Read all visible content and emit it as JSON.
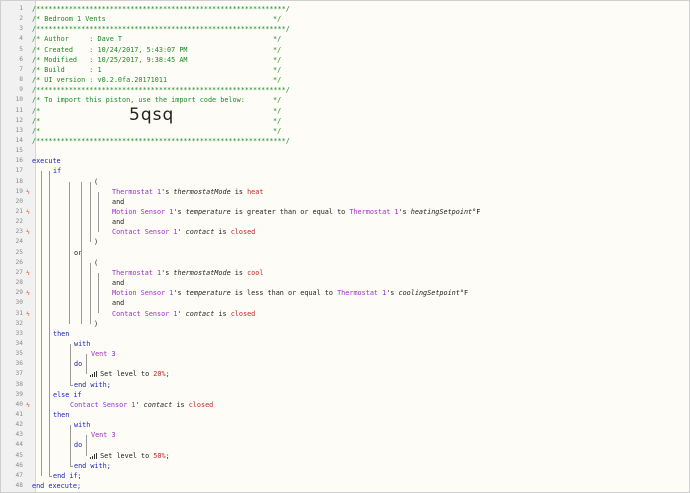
{
  "editor": {
    "line_numbers": [
      "1",
      "2",
      "3",
      "4",
      "5",
      "6",
      "7",
      "8",
      "9",
      "10",
      "11",
      "12",
      "13",
      "14",
      "15",
      "16",
      "17",
      "18",
      "19",
      "20",
      "21",
      "22",
      "23",
      "24",
      "25",
      "26",
      "27",
      "28",
      "29",
      "30",
      "31",
      "32",
      "33",
      "34",
      "35",
      "36",
      "37",
      "38",
      "39",
      "40",
      "41",
      "42",
      "43",
      "44",
      "45",
      "46",
      "47",
      "48"
    ],
    "marker_lines": [
      19,
      21,
      23,
      27,
      29,
      31,
      40
    ],
    "marker_glyph": "ϟ"
  },
  "header": {
    "rule": "/*************************************************************/",
    "title": "/* Bedroom 1 Vents",
    "author": "/* Author     : Dave T",
    "created": "/* Created    : 10/24/2017, 5:43:07 PM",
    "modified": "/* Modified   : 10/25/2017, 9:38:45 AM",
    "build": "/* Build      : 1",
    "ui_version": "/* UI version : v0.2.0fa.20171011",
    "import_note": "/* To import this piston, use the import code below:",
    "blank": "/*",
    "close": "*/",
    "import_code": "5qsq"
  },
  "code": {
    "execute": "execute",
    "if": "if",
    "open_paren": "(",
    "close_paren": ")",
    "or": "or",
    "and": "and",
    "then": "then",
    "with": "with",
    "do": "do",
    "end_with": "end with;",
    "else_if": "else if",
    "end_if": "end if;",
    "end_execute": "end execute;",
    "thermostat": "Thermostat 1",
    "s": "'s ",
    "thermostat_mode": "thermostatMode",
    "is": " is ",
    "heat": "heat",
    "cool": "cool",
    "motion_sensor": "Motion Sensor 1",
    "temperature": "temperature",
    "gte": " is greater than or equal to ",
    "lte": " is less than or equal to ",
    "heating_setpoint": "heatingSetpoint",
    "cooling_setpoint": "coolingSetpoint",
    "deg": "°F",
    "contact_sensor": "Contact Sensor 1",
    "apos": "' ",
    "contact": "contact",
    "closed": "closed",
    "vent": "Vent 3",
    "set_level_prefix": " Set level to ",
    "level_20": "20%",
    "level_50": "50%",
    "semi": ";"
  }
}
